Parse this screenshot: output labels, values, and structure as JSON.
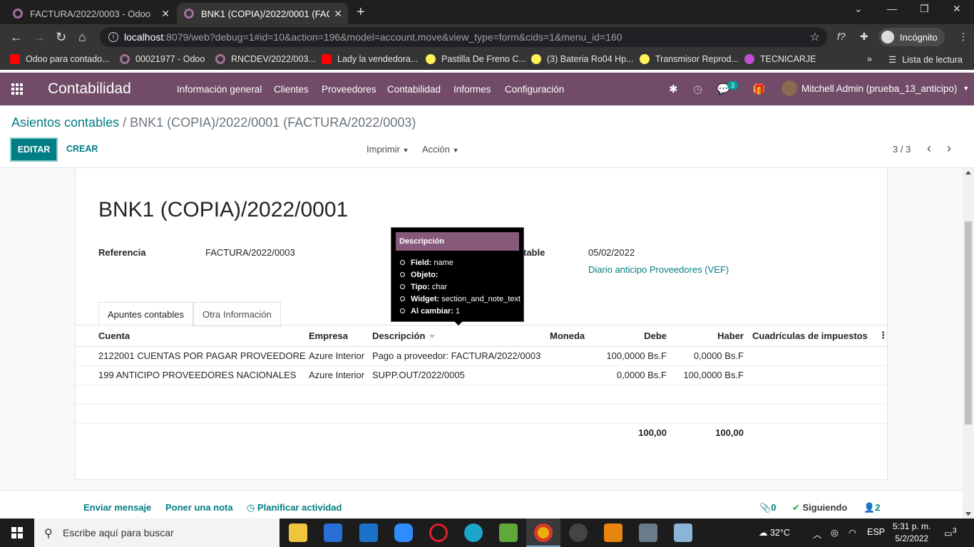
{
  "browser": {
    "tabs": [
      {
        "title": "FACTURA/2022/0003 - Odoo",
        "close": "✕"
      },
      {
        "title": "BNK1 (COPIA)/2022/0001 (FACTU",
        "close": "✕"
      }
    ],
    "url_host": "localhost",
    "url_path": ":8079/web?debug=1#id=10&action=196&model=account.move&view_type=form&cids=1&menu_id=160",
    "profile_label": "Incógnito",
    "bookmarks": [
      {
        "label": "Odoo para contado...",
        "icon": "youtube-icon"
      },
      {
        "label": "00021977 - Odoo",
        "icon": "odoo-icon"
      },
      {
        "label": "RNCDEV/2022/003...",
        "icon": "odoo-icon"
      },
      {
        "label": "Lady la vendedora...",
        "icon": "youtube-icon"
      },
      {
        "label": "Pastilla De Freno C...",
        "icon": "mercadolibre-icon"
      },
      {
        "label": "(3) Bateria Ro04 Hp...",
        "icon": "mercadolibre-icon"
      },
      {
        "label": "Transmisor Reprod...",
        "icon": "mercadolibre-icon"
      },
      {
        "label": "TECNICARJE",
        "icon": "play-icon"
      }
    ],
    "reading_list": "Lista de lectura"
  },
  "navbar": {
    "app_name": "Contabilidad",
    "menus": [
      "Información general",
      "Clientes",
      "Proveedores",
      "Contabilidad",
      "Informes",
      "Configuración"
    ],
    "messages_count": "3",
    "user": "Mitchell Admin (prueba_13_anticipo)"
  },
  "control_panel": {
    "breadcrumb_parent": "Asientos contables",
    "breadcrumb_sep": "/",
    "breadcrumb_current": "BNK1 (COPIA)/2022/0001 (FACTURA/2022/0003)",
    "edit_label": "EDITAR",
    "create_label": "CREAR",
    "print_label": "Imprimir",
    "action_label": "Acción",
    "pager": "3 / 3"
  },
  "form": {
    "title": "BNK1 (COPIA)/2022/0001",
    "ref_label": "Referencia",
    "ref_value": "FACTURA/2022/0003",
    "date_label_partial": "table",
    "date_value": "05/02/2022",
    "journal_value": "Diario anticipo Proveedores (VEF)",
    "tabs": [
      "Apuntes contables",
      "Otra Información"
    ],
    "columns": [
      "Cuenta",
      "Empresa",
      "Descripción",
      "Moneda",
      "Debe",
      "Haber",
      "Cuadrículas de impuestos"
    ],
    "rows": [
      {
        "account": "2122001 CUENTAS POR PAGAR PROVEEDORES",
        "partner": "Azure Interior",
        "name": "Pago a proveedor: FACTURA/2022/0003",
        "currency": "",
        "debit": "100,0000 Bs.F",
        "credit": "0,0000 Bs.F",
        "tax": ""
      },
      {
        "account": "199 ANTICIPO PROVEEDORES NACIONALES",
        "partner": "Azure Interior",
        "name": "SUPP.OUT/2022/0005",
        "currency": "",
        "debit": "0,0000 Bs.F",
        "credit": "100,0000 Bs.F",
        "tax": ""
      }
    ],
    "total_debit": "100,00",
    "total_credit": "100,00"
  },
  "tooltip": {
    "title": "Descripción",
    "items": [
      {
        "key": "Field:",
        "value": "name"
      },
      {
        "key": "Objeto:",
        "value": ""
      },
      {
        "key": "Tipo:",
        "value": "char"
      },
      {
        "key": "Widget:",
        "value": "section_and_note_text"
      },
      {
        "key": "Al cambiar:",
        "value": "1"
      }
    ]
  },
  "chatter": {
    "send_message": "Enviar mensaje",
    "log_note": "Poner una nota",
    "schedule": "Planificar actividad",
    "attachments": "0",
    "following": "Siguiendo",
    "followers": "2"
  },
  "taskbar": {
    "search_placeholder": "Escribe aquí para buscar",
    "weather": "32°C",
    "lang": "ESP",
    "time": "5:31 p. m.",
    "date": "5/2/2022",
    "notifications": "3"
  },
  "colors": {
    "odoo_primary": "#714b67",
    "accent_teal": "#017e84"
  }
}
